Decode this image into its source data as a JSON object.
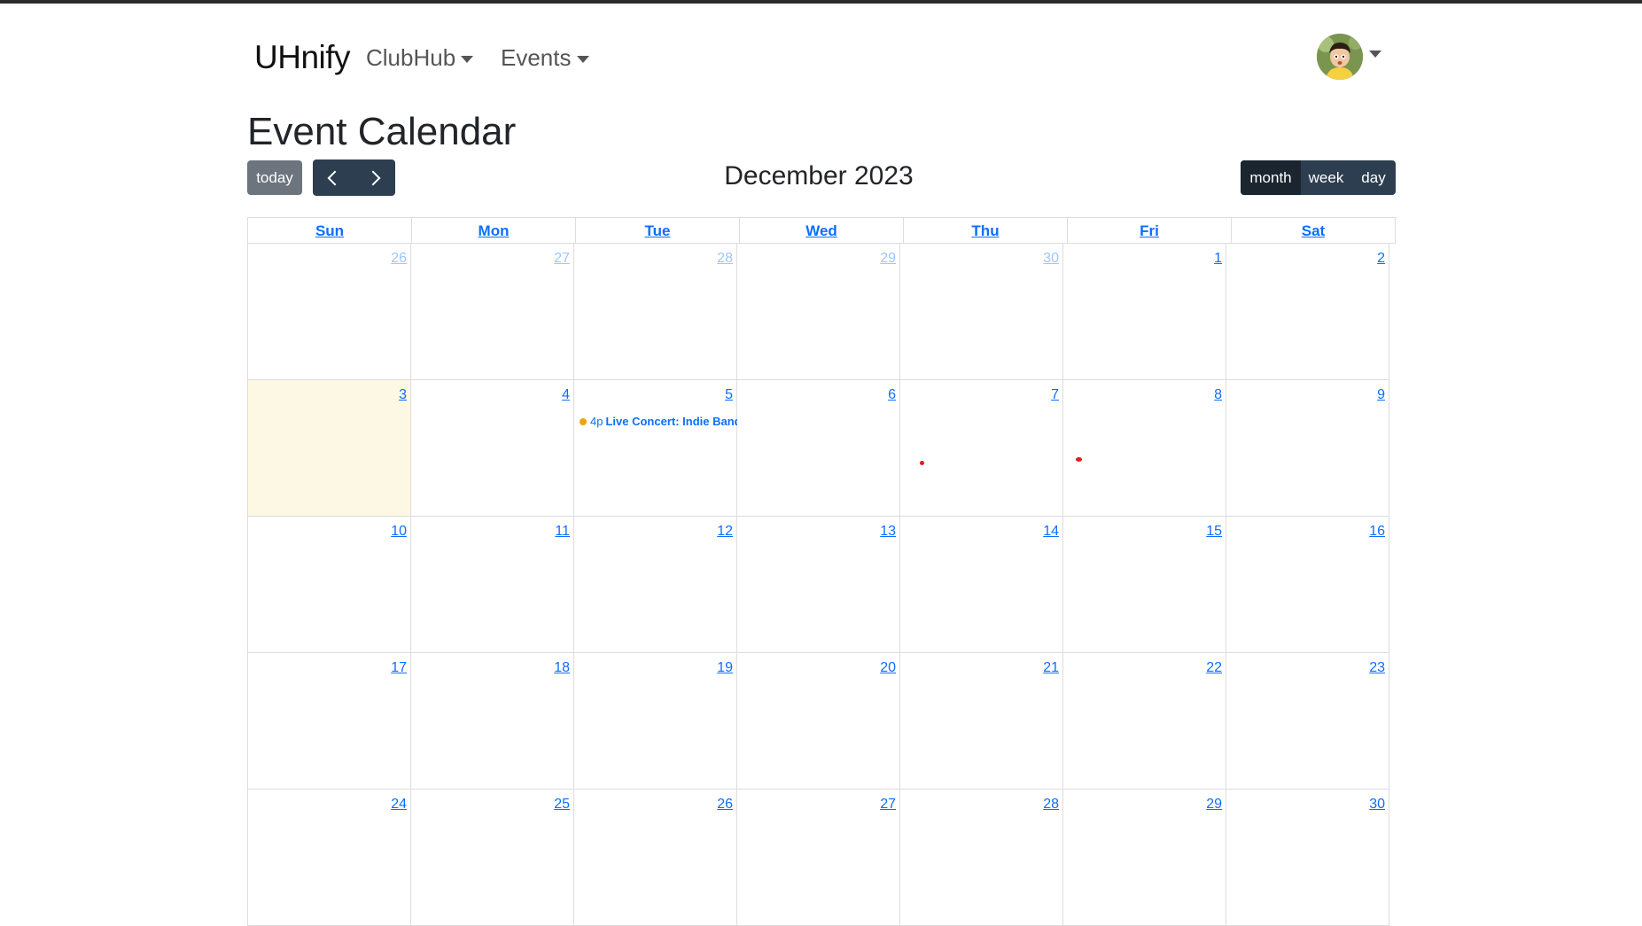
{
  "navbar": {
    "brand": "UHnify",
    "menus": [
      {
        "label": "ClubHub"
      },
      {
        "label": "Events"
      }
    ]
  },
  "page": {
    "title": "Event Calendar"
  },
  "toolbar": {
    "today_label": "today",
    "title": "December 2023",
    "views": [
      {
        "label": "month",
        "active": true
      },
      {
        "label": "week",
        "active": false
      },
      {
        "label": "day",
        "active": false
      }
    ]
  },
  "calendar": {
    "weekdays": [
      "Sun",
      "Mon",
      "Tue",
      "Wed",
      "Thu",
      "Fri",
      "Sat"
    ],
    "weeks": [
      [
        "26",
        "27",
        "28",
        "29",
        "30",
        "1",
        "2"
      ],
      [
        "3",
        "4",
        "5",
        "6",
        "7",
        "8",
        "9"
      ],
      [
        "10",
        "11",
        "12",
        "13",
        "14",
        "15",
        "16"
      ],
      [
        "17",
        "18",
        "19",
        "20",
        "21",
        "22",
        "23"
      ],
      [
        "24",
        "25",
        "26",
        "27",
        "28",
        "29",
        "30"
      ]
    ],
    "event": {
      "time": "4p",
      "title": "Live Concert: Indie Band Night",
      "dot_color": "#f0a30a"
    }
  },
  "colors": {
    "link": "#0d6efd",
    "button_dark": "#2c3e50",
    "button_active": "#1a252f",
    "today_button": "#6c757d",
    "today_cell": "#fcf8e3"
  }
}
